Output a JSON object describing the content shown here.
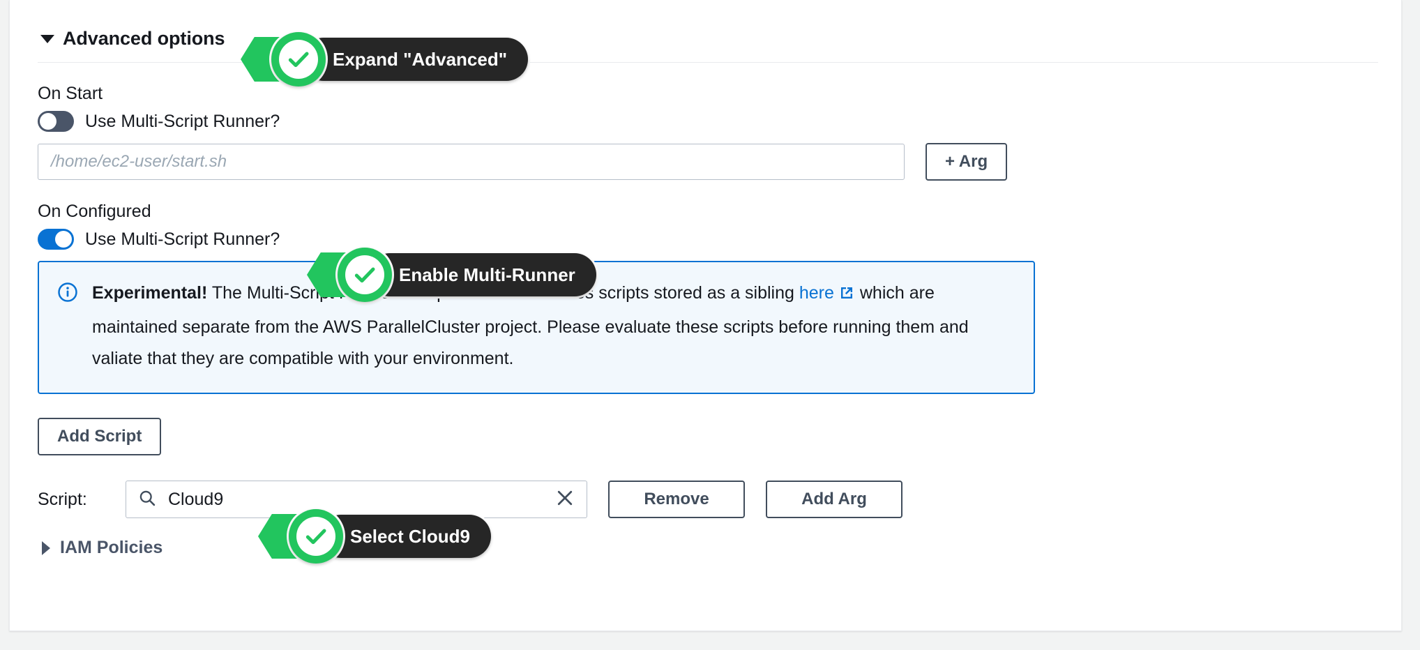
{
  "section": {
    "title": "Advanced options",
    "expanded": true
  },
  "on_start": {
    "group_label": "On Start",
    "toggle_label": "Use Multi-Script Runner?",
    "toggle_state": "off",
    "script_path_value": "",
    "script_path_placeholder": "/home/ec2-user/start.sh",
    "add_arg_label": "+ Arg"
  },
  "on_configured": {
    "group_label": "On Configured",
    "toggle_label": "Use Multi-Script Runner?",
    "toggle_state": "on",
    "alert": {
      "icon": "info-circle-icon",
      "strong": "Experimental!",
      "text_before_link": " The Multi-Script Runner is experimental and uses scripts stored as a sibling ",
      "link_text": "here",
      "link_icon": "external-link-icon",
      "text_after_link": "which are maintained separate from the AWS ParallelCluster project. Please evaluate these scripts before running them and valiate that they are compatible with your environment."
    },
    "add_script_label": "Add Script",
    "script_row": {
      "label": "Script:",
      "search_icon": "search-icon",
      "value": "Cloud9",
      "clear_icon": "close-icon",
      "remove_label": "Remove",
      "add_arg_label": "Add Arg"
    }
  },
  "iam_policies": {
    "title": "IAM Policies",
    "expanded": false
  },
  "annotations": [
    {
      "id": "expand-advanced",
      "label": "Expand \"Advanced\""
    },
    {
      "id": "enable-multi-runner",
      "label": "Enable Multi-Runner"
    },
    {
      "id": "select-cloud9",
      "label": "Select Cloud9"
    }
  ],
  "colors": {
    "accent_blue": "#0972d3",
    "annotation_green": "#22c55e",
    "annotation_pill": "#262626",
    "alert_bg": "#f2f8fd",
    "button_border": "#414d5c"
  }
}
